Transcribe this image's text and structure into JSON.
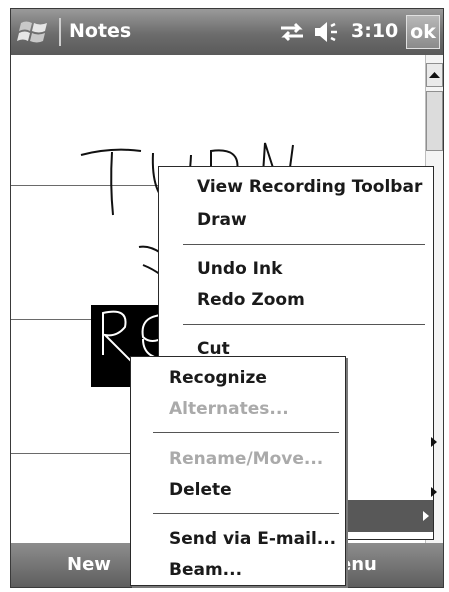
{
  "window": {
    "app_title": "Notes",
    "clock": "3:10",
    "ok_label": "ok"
  },
  "icons": {
    "start": "windows-flag-icon",
    "connectivity": "connectivity-arrows-icon",
    "volume": "speaker-volume-icon"
  },
  "note": {
    "handwriting_lines": [
      "TURN",
      "RE"
    ]
  },
  "context_menu": {
    "items": [
      {
        "label": "View Recording Toolbar",
        "disabled": false
      },
      {
        "label": "Draw",
        "disabled": false
      },
      {
        "label": "Undo Ink",
        "disabled": false
      },
      {
        "label": "Redo Zoom",
        "disabled": false
      },
      {
        "label": "Cut",
        "disabled": false
      }
    ]
  },
  "sub_menu": {
    "items": [
      {
        "label": "Recognize",
        "disabled": false
      },
      {
        "label": "Alternates...",
        "disabled": true
      },
      {
        "label": "Rename/Move...",
        "disabled": true
      },
      {
        "label": "Delete",
        "disabled": false
      },
      {
        "label": "Send via E-mail...",
        "disabled": false
      },
      {
        "label": "Beam...",
        "disabled": false
      }
    ]
  },
  "bottombar": {
    "new_label": "New",
    "menu_label_visible": "enu"
  },
  "colors": {
    "titlebar": "#6c6c6c",
    "highlight": "#585858",
    "disabled_text": "#aaaaaa"
  }
}
